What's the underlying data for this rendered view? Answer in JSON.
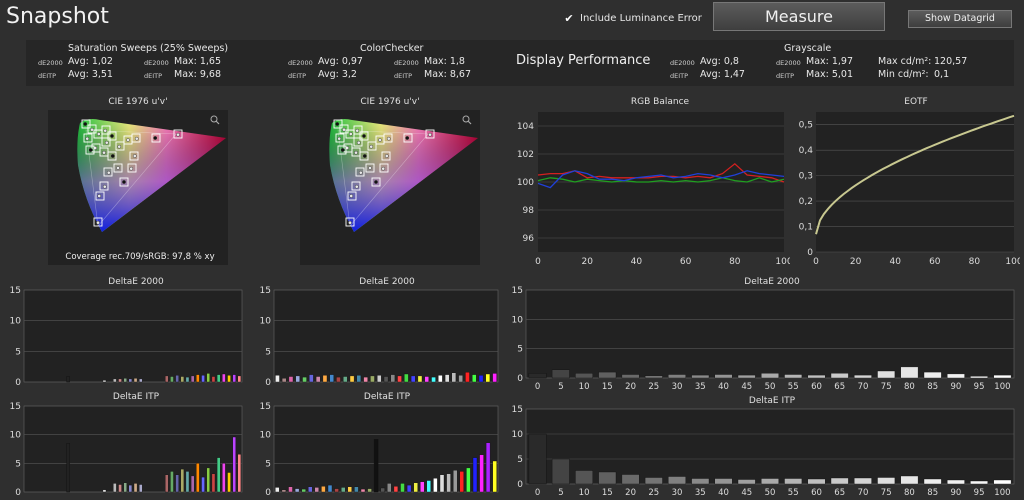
{
  "header": {
    "title": "Snapshot",
    "include_luminance_label": "Include Luminance Error",
    "include_luminance_checked": true,
    "measure_label": "Measure",
    "datagrid_label": "Show Datagrid"
  },
  "summary": {
    "saturation": {
      "title": "Saturation Sweeps (25% Sweeps)",
      "r1": {
        "tag": "dE2000",
        "avg": "Avg: 1,02",
        "max": "Max: 1,65"
      },
      "r2": {
        "tag": "dEITP",
        "avg": "Avg: 3,51",
        "max": "Max: 9,68"
      }
    },
    "colorchecker": {
      "title": "ColorChecker",
      "r1": {
        "tag": "dE2000",
        "avg": "Avg: 0,97",
        "max": "Max: 1,8"
      },
      "r2": {
        "tag": "dEITP",
        "avg": "Avg: 3,2",
        "max": "Max: 8,67"
      }
    },
    "display_performance": "Display Performance",
    "grayscale": {
      "title": "Grayscale",
      "r1": {
        "tag": "dE2000",
        "avg": "Avg: 0,8",
        "max": "Max: 1,97"
      },
      "r2": {
        "tag": "dEITP",
        "avg": "Avg: 1,47",
        "max": "Max: 5,01"
      },
      "maxcd": "Max cd/m²:",
      "maxcd_val": "120,57",
      "mincd": "Min cd/m²:",
      "mincd_val": "0,1"
    }
  },
  "cie": {
    "title_left": "CIE 1976 u'v'",
    "title_right": "CIE 1976 u'v'",
    "coverage": "Coverage rec.709/sRGB:  97,8 % xy",
    "zoom_icon": "magnifier-icon"
  },
  "chart_data": [
    {
      "type": "line",
      "title": "RGB Balance",
      "x": [
        0,
        5,
        10,
        15,
        20,
        25,
        30,
        35,
        40,
        45,
        50,
        55,
        60,
        65,
        70,
        75,
        80,
        85,
        90,
        95,
        100
      ],
      "xticks": [
        0,
        20,
        40,
        60,
        80,
        100
      ],
      "yticks": [
        96,
        98,
        100,
        102,
        104
      ],
      "ylim": [
        95,
        105
      ],
      "xlim": [
        0,
        100
      ],
      "series": [
        {
          "color": "#d42020",
          "values": [
            100.5,
            100.6,
            100.6,
            100.8,
            100.3,
            100.4,
            100.3,
            100.3,
            100.3,
            100.3,
            100.4,
            100.4,
            100.3,
            100.4,
            100.3,
            100.6,
            101.3,
            100.5,
            100.4,
            100.3,
            100.0
          ]
        },
        {
          "color": "#20a020",
          "values": [
            100.1,
            100.3,
            100.2,
            100.0,
            100.2,
            100.1,
            100.0,
            100.1,
            100.0,
            100.0,
            100.1,
            100.0,
            100.1,
            100.0,
            100.1,
            100.3,
            100.1,
            100.0,
            100.3,
            100.0,
            100.2
          ]
        },
        {
          "color": "#2040d8",
          "values": [
            99.9,
            99.6,
            100.5,
            100.8,
            100.6,
            100.2,
            100.2,
            100.1,
            100.3,
            100.4,
            100.5,
            100.3,
            100.4,
            100.6,
            100.5,
            100.3,
            100.5,
            100.8,
            100.6,
            100.5,
            100.4
          ]
        }
      ]
    },
    {
      "type": "line",
      "title": "EOTF",
      "xticks": [
        0,
        20,
        40,
        60,
        80,
        100
      ],
      "yticks": [
        0,
        0.1,
        0.2,
        0.3,
        0.4,
        0.5
      ],
      "ytick_labels": [
        "0",
        "0,1",
        "0,2",
        "0,3",
        "0,4",
        "0,5"
      ],
      "xlim": [
        0,
        100
      ],
      "ylim": [
        0,
        0.55
      ],
      "gamma": 0.55,
      "y0": 0.07,
      "y100": 0.535
    },
    {
      "type": "bar",
      "title": "DeltaE 2000",
      "yticks": [
        0,
        5,
        10,
        15
      ],
      "ylim": [
        0,
        15
      ],
      "values": [
        0,
        0,
        0,
        0,
        0,
        0,
        0,
        0,
        0.9,
        0,
        0,
        0,
        0,
        0,
        0,
        0.3,
        0,
        0.5,
        0.5,
        0.6,
        0.5,
        0.6,
        0.5,
        0,
        0,
        0,
        0,
        1.0,
        0.9,
        1.1,
        0.9,
        0.8,
        1.0,
        1.2,
        1.1,
        1.4,
        0.9,
        1.2,
        1.3,
        1.1,
        1.2,
        1.0
      ],
      "colors": [
        "#444",
        "#444",
        "#444",
        "#444",
        "#444",
        "#444",
        "#444",
        "#444",
        "#222",
        "#444",
        "#444",
        "#444",
        "#444",
        "#444",
        "#444",
        "#ddd",
        "#444",
        "#bbb",
        "#c88",
        "#8a8",
        "#88c",
        "#ca8",
        "#aac",
        "#444",
        "#444",
        "#444",
        "#444",
        "#a66",
        "#6a6",
        "#66a",
        "#aa6",
        "#6aa",
        "#a6a",
        "#f80",
        "#66f",
        "#8c4",
        "#c44",
        "#4c8",
        "#e4e",
        "#fc0",
        "#b4f",
        "#f88"
      ]
    },
    {
      "type": "bar",
      "title": "DeltaE 2000",
      "yticks": [
        0,
        5,
        10,
        15
      ],
      "ylim": [
        0,
        15
      ],
      "values": [
        1.1,
        0.6,
        0.9,
        1.0,
        0.8,
        1.2,
        0.9,
        1.1,
        1.2,
        0.8,
        0.9,
        1.0,
        1.1,
        0.8,
        1.0,
        1.1,
        0.9,
        1.2,
        1.0,
        1.3,
        1.0,
        1.0,
        0.9,
        0.8,
        1.1,
        1.2,
        1.5,
        1.1,
        1.6,
        1.2,
        1.1,
        1.3,
        1.4
      ],
      "colors": [
        "#eee",
        "#a88",
        "#d6a",
        "#9ad",
        "#6c6",
        "#66d",
        "#c8a",
        "#fa4",
        "#48c",
        "#a44",
        "#6a8",
        "#fc4",
        "#48a",
        "#e8a",
        "#9a6",
        "#ccc",
        "#555",
        "#888",
        "#f44",
        "#4d4",
        "#44f",
        "#ee4",
        "#f4f",
        "#4ff",
        "#fff",
        "#ddd",
        "#bbb",
        "#999",
        "#f22",
        "#4f4",
        "#22f",
        "#ff2",
        "#f2f"
      ]
    },
    {
      "type": "bar",
      "title": "DeltaE 2000",
      "categories": [
        "0",
        "5",
        "10",
        "15",
        "20",
        "25",
        "30",
        "35",
        "40",
        "45",
        "50",
        "55",
        "60",
        "65",
        "70",
        "75",
        "80",
        "85",
        "90",
        "95",
        "100"
      ],
      "yticks": [
        0,
        5,
        10,
        15
      ],
      "ylim": [
        0,
        15
      ],
      "values": [
        0.8,
        1.4,
        0.8,
        1.0,
        0.6,
        0.4,
        0.6,
        0.5,
        0.6,
        0.5,
        0.8,
        0.6,
        0.5,
        0.8,
        0.5,
        1.2,
        1.9,
        1.0,
        0.7,
        0.3,
        0.5
      ],
      "colors": [
        "#2a2a2a",
        "#444",
        "#555",
        "#606060",
        "#6a6a6a",
        "#757575",
        "#808080",
        "#8a8a8a",
        "#959595",
        "#a0a0a0",
        "#aaaaaa",
        "#b5b5b5",
        "#c0c0c0",
        "#cacaca",
        "#d5d5d5",
        "#dfdfdf",
        "#e6e6e6",
        "#eeeeee",
        "#f2f2f2",
        "#f7f7f7",
        "#ffffff"
      ]
    },
    {
      "type": "bar",
      "title": "DeltaE ITP",
      "yticks": [
        0,
        5,
        10,
        15
      ],
      "ylim": [
        0,
        15
      ],
      "values": [
        0,
        0,
        0,
        0,
        0,
        0,
        0,
        0,
        8.5,
        0,
        0,
        0,
        0,
        0,
        0,
        0.4,
        0,
        1.5,
        1.3,
        1.6,
        1.2,
        1.5,
        1.3,
        0,
        0,
        0,
        0,
        3.0,
        3.6,
        3.0,
        4.0,
        3.6,
        2.8,
        5.0,
        2.6,
        4.2,
        3.2,
        6.0,
        5.0,
        3.4,
        9.6,
        6.6
      ],
      "colors": [
        "#444",
        "#444",
        "#444",
        "#444",
        "#444",
        "#444",
        "#444",
        "#444",
        "#222",
        "#444",
        "#444",
        "#444",
        "#444",
        "#444",
        "#444",
        "#ddd",
        "#444",
        "#bbb",
        "#c88",
        "#8a8",
        "#88c",
        "#ca8",
        "#aac",
        "#444",
        "#444",
        "#444",
        "#444",
        "#a66",
        "#6a6",
        "#66a",
        "#aa6",
        "#6aa",
        "#a6a",
        "#f80",
        "#66f",
        "#8c4",
        "#c44",
        "#4c8",
        "#e4e",
        "#fc0",
        "#b4f",
        "#f88"
      ]
    },
    {
      "type": "bar",
      "title": "DeltaE ITP",
      "yticks": [
        0,
        5,
        10,
        15
      ],
      "ylim": [
        0,
        15
      ],
      "values": [
        0.8,
        0.4,
        0.9,
        0.6,
        0.5,
        0.9,
        0.8,
        1.0,
        1.2,
        0.6,
        0.8,
        0.9,
        0.9,
        0.5,
        0.6,
        9.2,
        0.7,
        1.5,
        1.0,
        1.5,
        1.2,
        1.6,
        1.8,
        2.0,
        2.4,
        3.0,
        3.2,
        3.8,
        3.6,
        4.2,
        6.0,
        6.5,
        8.6,
        5.4
      ],
      "colors": [
        "#eee",
        "#a88",
        "#d6a",
        "#9ad",
        "#6c6",
        "#66d",
        "#c8a",
        "#fa4",
        "#48c",
        "#a44",
        "#6a8",
        "#fc4",
        "#48a",
        "#e8a",
        "#9a6",
        "#111",
        "#555",
        "#888",
        "#f44",
        "#4d4",
        "#44f",
        "#ee4",
        "#f4f",
        "#4ff",
        "#fff",
        "#ddd",
        "#bbb",
        "#999",
        "#f22",
        "#4f4",
        "#22f",
        "#f2f",
        "#a2f",
        "#ff2"
      ]
    },
    {
      "type": "bar",
      "title": "DeltaE ITP",
      "categories": [
        "0",
        "5",
        "10",
        "15",
        "20",
        "25",
        "30",
        "35",
        "40",
        "45",
        "50",
        "55",
        "60",
        "65",
        "70",
        "75",
        "80",
        "85",
        "90",
        "95",
        "100"
      ],
      "yticks": [
        0,
        5,
        10,
        15
      ],
      "ylim": [
        0,
        15
      ],
      "values": [
        10.0,
        5.0,
        2.7,
        2.4,
        1.9,
        1.3,
        1.5,
        1.1,
        1.1,
        0.9,
        1.1,
        1.1,
        1.0,
        1.2,
        1.2,
        1.3,
        1.6,
        1.0,
        0.8,
        0.6,
        0.8
      ],
      "colors": [
        "#2a2a2a",
        "#444",
        "#555",
        "#606060",
        "#6a6a6a",
        "#757575",
        "#808080",
        "#8a8a8a",
        "#959595",
        "#a0a0a0",
        "#aaaaaa",
        "#b5b5b5",
        "#c0c0c0",
        "#cacaca",
        "#d5d5d5",
        "#dfdfdf",
        "#e6e6e6",
        "#eeeeee",
        "#f2f2f2",
        "#f7f7f7",
        "#ffffff"
      ]
    }
  ]
}
